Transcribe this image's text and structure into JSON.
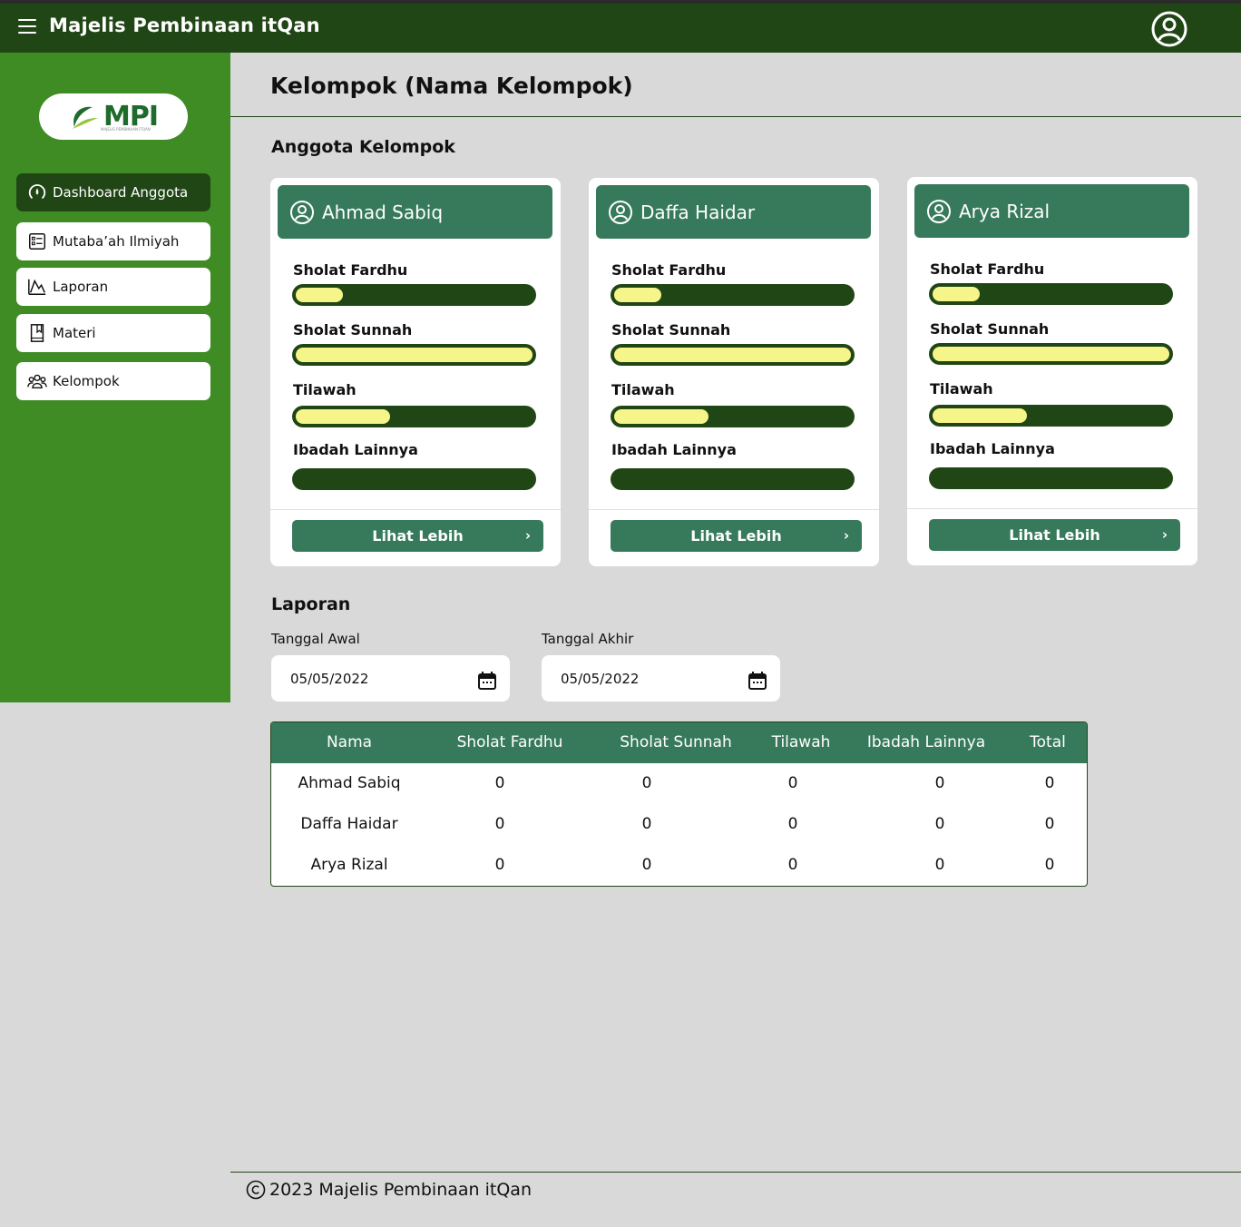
{
  "header": {
    "title": "Majelis Pembinaan itQan"
  },
  "sidebar": {
    "logo_text": "MPI",
    "logo_subtext": "MAJELIS PEMBINAAN ITQAN",
    "items": [
      {
        "label": "Dashboard Anggota",
        "icon": "dashboard-icon",
        "active": true
      },
      {
        "label": "Mutaba’ah Ilmiyah",
        "icon": "checklist-icon",
        "active": false
      },
      {
        "label": "Laporan",
        "icon": "chart-line-icon",
        "active": false
      },
      {
        "label": "Materi",
        "icon": "book-icon",
        "active": false
      },
      {
        "label": "Kelompok",
        "icon": "group-icon",
        "active": false
      }
    ]
  },
  "main": {
    "page_title": "Kelompok (Nama Kelompok)",
    "members_title": "Anggota Kelompok",
    "report_title": "Laporan",
    "metric_labels": [
      "Sholat Fardhu",
      "Sholat Sunnah",
      "Tilawah",
      "Ibadah Lainnya"
    ],
    "more_label": "Lihat Lebih",
    "members": [
      {
        "name": "Ahmad Sabiq",
        "progress": [
          0.2,
          1.0,
          0.4,
          0.0
        ]
      },
      {
        "name": "Daffa Haidar",
        "progress": [
          0.2,
          1.0,
          0.4,
          0.0
        ]
      },
      {
        "name": "Arya Rizal",
        "progress": [
          0.2,
          1.0,
          0.4,
          0.0
        ]
      }
    ],
    "start_date": {
      "label": "Tanggal Awal",
      "value": "05/05/2022"
    },
    "end_date": {
      "label": "Tanggal Akhir",
      "value": "05/05/2022"
    },
    "table": {
      "headers": [
        "Nama",
        "Sholat Fardhu",
        "Sholat Sunnah",
        "Tilawah",
        "Ibadah Lainnya",
        "Total"
      ],
      "rows": [
        [
          "Ahmad Sabiq",
          "0",
          "0",
          "0",
          "0",
          "0"
        ],
        [
          "Daffa Haidar",
          "0",
          "0",
          "0",
          "0",
          "0"
        ],
        [
          "Arya Rizal",
          "0",
          "0",
          "0",
          "0",
          "0"
        ]
      ]
    }
  },
  "footer": {
    "text": "2023 Majelis Pembinaan itQan"
  },
  "colors": {
    "topbar": "#214616",
    "sidebar": "#3f8c25",
    "card_header": "#377a5b",
    "bar_track": "#214616",
    "bar_fill": "#f5f58a",
    "background": "#d9d9d9"
  }
}
